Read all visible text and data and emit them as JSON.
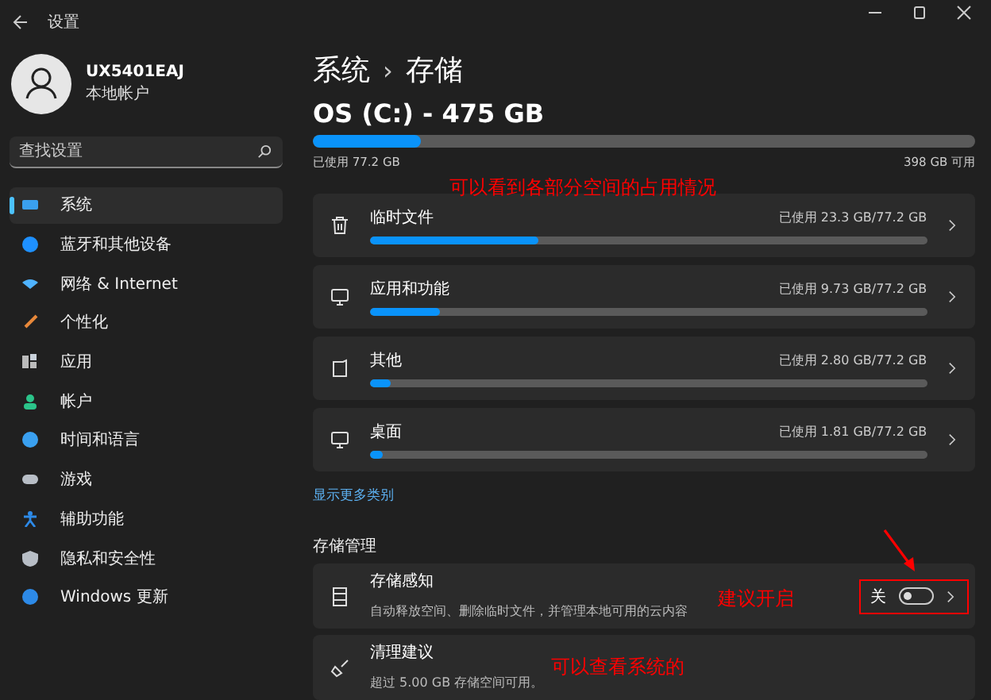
{
  "window": {
    "title": "设置"
  },
  "account": {
    "name": "UX5401EAJ",
    "type": "本地帐户"
  },
  "search": {
    "placeholder": "查找设置"
  },
  "sidebar": {
    "items": [
      {
        "label": "系统",
        "selected": true
      },
      {
        "label": "蓝牙和其他设备",
        "selected": false
      },
      {
        "label": "网络 & Internet",
        "selected": false
      },
      {
        "label": "个性化",
        "selected": false
      },
      {
        "label": "应用",
        "selected": false
      },
      {
        "label": "帐户",
        "selected": false
      },
      {
        "label": "时间和语言",
        "selected": false
      },
      {
        "label": "游戏",
        "selected": false
      },
      {
        "label": "辅助功能",
        "selected": false
      },
      {
        "label": "隐私和安全性",
        "selected": false
      },
      {
        "label": "Windows 更新",
        "selected": false
      }
    ]
  },
  "breadcrumb": [
    "系统",
    "›",
    "存储"
  ],
  "drive": {
    "title": "OS (C:) - 475 GB",
    "level": 0.163,
    "used": "已使用 77.2 GB",
    "free": "398 GB 可用"
  },
  "categories": [
    {
      "name": "临时文件",
      "usage": "已使用 23.3 GB/77.2 GB",
      "level": 0.302
    },
    {
      "name": "应用和功能",
      "usage": "已使用 9.73 GB/77.2 GB",
      "level": 0.126
    },
    {
      "name": "其他",
      "usage": "已使用 2.80 GB/77.2 GB",
      "level": 0.036
    },
    {
      "name": "桌面",
      "usage": "已使用 1.81 GB/77.2 GB",
      "level": 0.023
    }
  ],
  "show_more": "显示更多类别",
  "management": {
    "heading": "存储管理",
    "storage_sense": {
      "title": "存储感知",
      "description": "自动释放空间、删除临时文件，并管理本地可用的云内容",
      "toggle_label": "关",
      "on": false
    },
    "cleanup": {
      "title": "清理建议",
      "description": "超过 5.00 GB 存储空间可用。"
    }
  },
  "annotations": [
    "可以看到各部分空间的占用情况",
    "建议开启",
    "可以查看系统的"
  ]
}
